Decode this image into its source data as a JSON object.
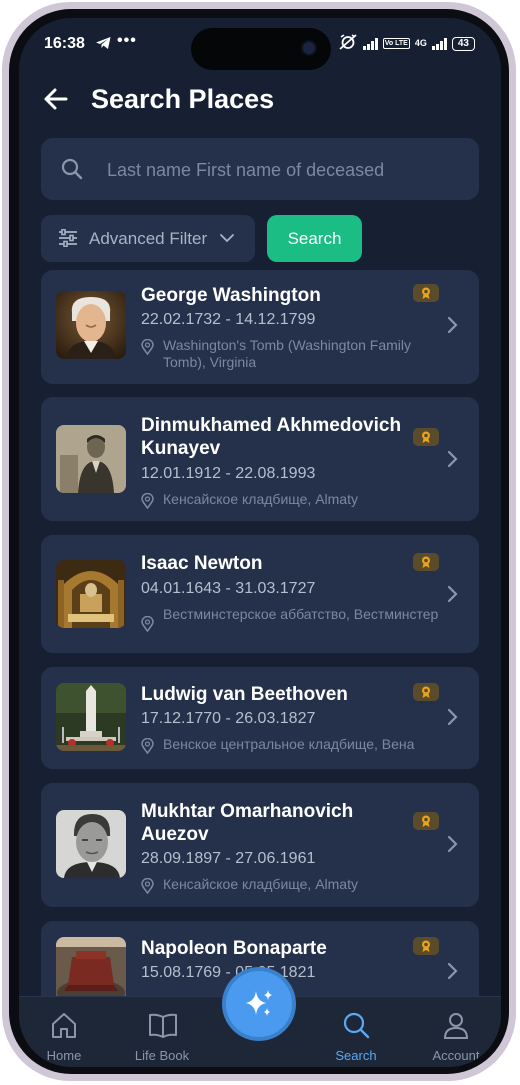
{
  "status_bar": {
    "time": "16:38",
    "telegram_icon": "telegram-icon",
    "more": "•••",
    "network_type": "4G",
    "volte": "Vo LTE",
    "battery": "43"
  },
  "header": {
    "title": "Search Places",
    "back_icon": "arrow-left-icon"
  },
  "search": {
    "placeholder": "Last name First name of deceased",
    "value": "",
    "filter_label": "Advanced Filter",
    "button_label": "Search"
  },
  "results": [
    {
      "name": "George Washington",
      "dates": "22.02.1732 - 14.12.1799",
      "place": "Washington's Tomb (Washington Family Tomb), Virginia"
    },
    {
      "name": "Dinmukhamed Akhmedovich Kunayev",
      "dates": "12.01.1912 - 22.08.1993",
      "place": "Кенсайское кладбище, Almaty"
    },
    {
      "name": "Isaac Newton",
      "dates": "04.01.1643 - 31.03.1727",
      "place": "Вестминстерское аббатство, Вестминстер"
    },
    {
      "name": "Ludwig van Beethoven",
      "dates": "17.12.1770 - 26.03.1827",
      "place": "Венское центральное кладбище, Вена"
    },
    {
      "name": "Mukhtar Omarhanovich Auezov",
      "dates": "28.09.1897 - 27.06.1961",
      "place": "Кенсайское кладбище, Almaty"
    },
    {
      "name": "Napoleon Bonaparte",
      "dates": "15.08.1769 - 05.05.1821",
      "place": ""
    }
  ],
  "tabbar": {
    "home": "Home",
    "life_book": "Life Book",
    "search": "Search",
    "account": "Account"
  },
  "colors": {
    "background": "#172033",
    "card": "#25314a",
    "accent_green": "#1bbd84",
    "active_tab": "#5aa9f2",
    "badge": "#e8a31f"
  }
}
